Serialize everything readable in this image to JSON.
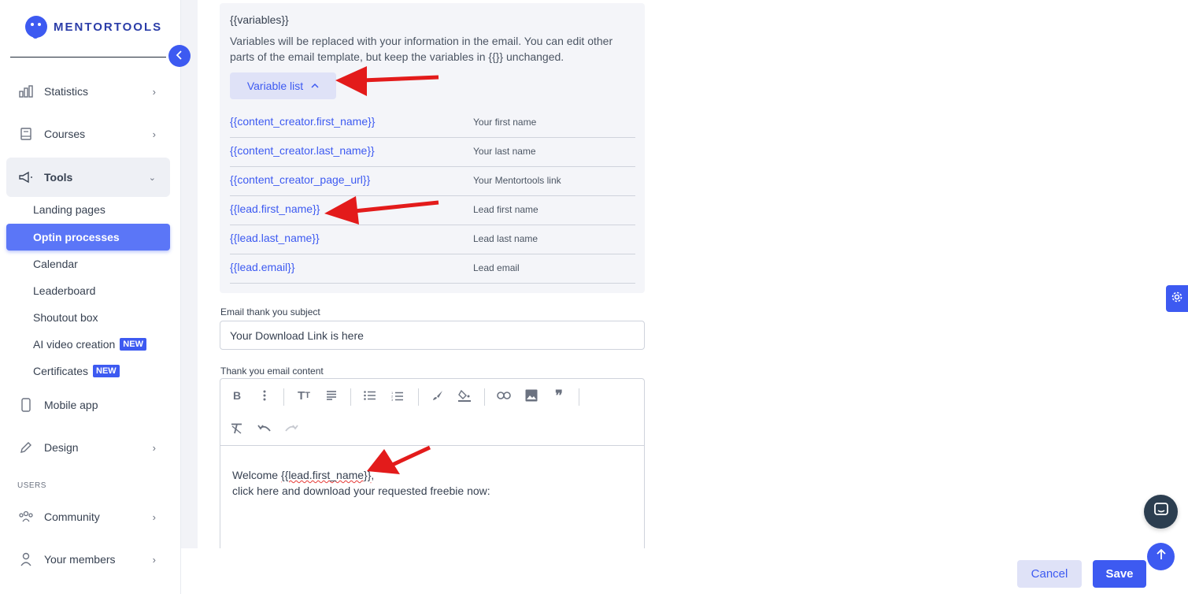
{
  "brand": {
    "name": "MENTORTOOLS",
    "accent": "#3d5af1"
  },
  "sidebar": {
    "collapse_icon": "chevron-left-icon",
    "items": [
      {
        "label": "Statistics",
        "icon": "bar-chart-icon"
      },
      {
        "label": "Courses",
        "icon": "book-icon"
      },
      {
        "label": "Tools",
        "icon": "megaphone-icon"
      },
      {
        "label": "Mobile app",
        "icon": "phone-icon"
      },
      {
        "label": "Design",
        "icon": "pencil-icon"
      },
      {
        "label": "Community",
        "icon": "community-icon"
      },
      {
        "label": "Your members",
        "icon": "user-icon"
      }
    ],
    "tools_sub": [
      {
        "label": "Landing pages"
      },
      {
        "label": "Optin processes"
      },
      {
        "label": "Calendar"
      },
      {
        "label": "Leaderboard"
      },
      {
        "label": "Shoutout box"
      },
      {
        "label": "AI video creation",
        "badge": "NEW"
      },
      {
        "label": "Certificates",
        "badge": "NEW"
      }
    ],
    "section_users": "USERS"
  },
  "variables_panel": {
    "title": "{{variables}}",
    "description": "Variables will be replaced with your information in the email. You can edit other parts of the email template, but keep the variables in {{}} unchanged.",
    "button_label": "Variable list",
    "rows": [
      {
        "key": "{{content_creator.first_name}}",
        "desc": "Your first name"
      },
      {
        "key": "{{content_creator.last_name}}",
        "desc": "Your last name"
      },
      {
        "key": "{{content_creator_page_url}}",
        "desc": "Your Mentortools link"
      },
      {
        "key": "{{lead.first_name}}",
        "desc": "Lead first name"
      },
      {
        "key": "{{lead.last_name}}",
        "desc": "Lead last name"
      },
      {
        "key": "{{lead.email}}",
        "desc": "Lead email"
      }
    ]
  },
  "subject": {
    "label": "Email thank you subject",
    "value": "Your Download Link is here"
  },
  "content": {
    "label": "Thank you email content",
    "line1_prefix": "Welcome ",
    "line1_var": "{{lead.first_name}}",
    "line1_suffix": ",",
    "line2": "click here and download your requested freebie now:"
  },
  "footer": {
    "cancel_label": "Cancel",
    "save_label": "Save"
  }
}
